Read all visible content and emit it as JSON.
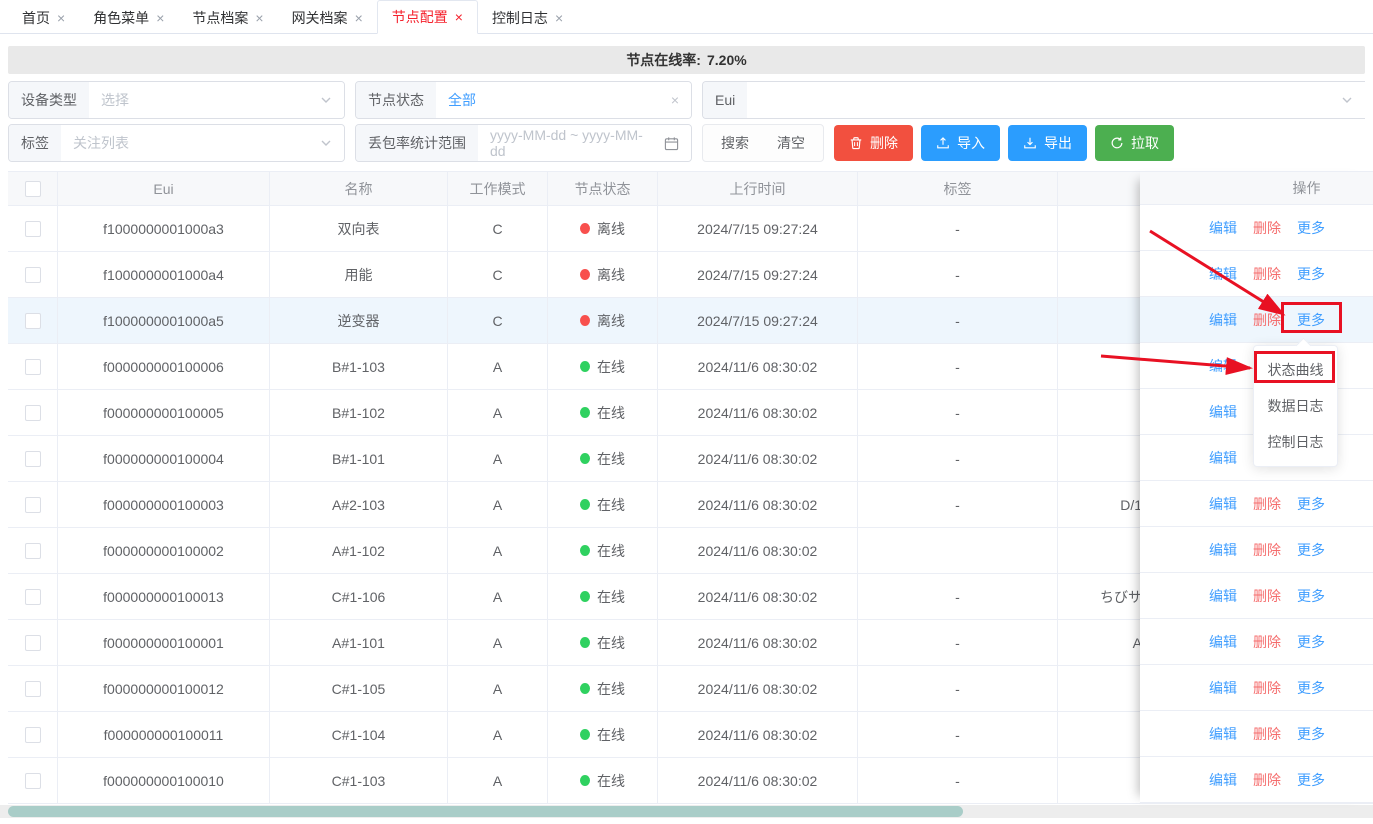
{
  "close_glyph": "×",
  "tabs": [
    {
      "label": "首页",
      "active": false
    },
    {
      "label": "角色菜单",
      "active": false
    },
    {
      "label": "节点档案",
      "active": false
    },
    {
      "label": "网关档案",
      "active": false
    },
    {
      "label": "节点配置",
      "active": true
    },
    {
      "label": "控制日志",
      "active": false
    }
  ],
  "online_rate": {
    "label": "节点在线率:",
    "value": "7.20%"
  },
  "filters": {
    "device_type": {
      "label": "设备类型",
      "placeholder": "选择"
    },
    "node_status": {
      "label": "节点状态",
      "value": "全部"
    },
    "eui": {
      "label": "Eui",
      "value": ""
    },
    "tag": {
      "label": "标签",
      "placeholder": "关注列表"
    },
    "loss_range": {
      "label": "丢包率统计范围",
      "placeholder": "yyyy-MM-dd ~ yyyy-MM-dd"
    }
  },
  "buttons": {
    "search": "搜索",
    "clear": "清空",
    "delete": "删除",
    "import": "导入",
    "export": "导出",
    "pull": "拉取"
  },
  "table": {
    "columns": {
      "eui": "Eui",
      "name": "名称",
      "mode": "工作模式",
      "status": "节点状态",
      "time": "上行时间",
      "tag": "标签",
      "op": "操作"
    },
    "status_online": "在线",
    "status_offline": "离线",
    "actions": {
      "edit": "编辑",
      "delete": "删除",
      "more": "更多"
    },
    "rows": [
      {
        "eui": "f1000000001000a3",
        "name": "双向表",
        "mode": "C",
        "online": false,
        "time": "2024/7/15 09:27:24",
        "tag": "-",
        "extra": "",
        "highlighted": false
      },
      {
        "eui": "f1000000001000a4",
        "name": "用能",
        "mode": "C",
        "online": false,
        "time": "2024/7/15 09:27:24",
        "tag": "-",
        "extra": "",
        "highlighted": false
      },
      {
        "eui": "f1000000001000a5",
        "name": "逆变器",
        "mode": "C",
        "online": false,
        "time": "2024/7/15 09:27:24",
        "tag": "-",
        "extra": "",
        "highlighted": true
      },
      {
        "eui": "f000000000100006",
        "name": "B#1-103",
        "mode": "A",
        "online": true,
        "time": "2024/11/6 08:30:02",
        "tag": "-",
        "extra": "",
        "highlighted": false
      },
      {
        "eui": "f000000000100005",
        "name": "B#1-102",
        "mode": "A",
        "online": true,
        "time": "2024/11/6 08:30:02",
        "tag": "-",
        "extra": "",
        "highlighted": false
      },
      {
        "eui": "f000000000100004",
        "name": "B#1-101",
        "mode": "A",
        "online": true,
        "time": "2024/11/6 08:30:02",
        "tag": "-",
        "extra": "",
        "highlighted": false
      },
      {
        "eui": "f000000000100003",
        "name": "A#2-103",
        "mode": "A",
        "online": true,
        "time": "2024/11/6 08:30:02",
        "tag": "-",
        "extra": "D/1",
        "highlighted": false
      },
      {
        "eui": "f000000000100002",
        "name": "A#1-102",
        "mode": "A",
        "online": true,
        "time": "2024/11/6 08:30:02",
        "tag": "",
        "extra": "",
        "highlighted": false
      },
      {
        "eui": "f000000000100013",
        "name": "C#1-106",
        "mode": "A",
        "online": true,
        "time": "2024/11/6 08:30:02",
        "tag": "-",
        "extra": "ちびサ",
        "highlighted": false
      },
      {
        "eui": "f000000000100001",
        "name": "A#1-101",
        "mode": "A",
        "online": true,
        "time": "2024/11/6 08:30:02",
        "tag": "-",
        "extra": "A",
        "highlighted": false
      },
      {
        "eui": "f000000000100012",
        "name": "C#1-105",
        "mode": "A",
        "online": true,
        "time": "2024/11/6 08:30:02",
        "tag": "-",
        "extra": "",
        "highlighted": false
      },
      {
        "eui": "f000000000100011",
        "name": "C#1-104",
        "mode": "A",
        "online": true,
        "time": "2024/11/6 08:30:02",
        "tag": "-",
        "extra": "",
        "highlighted": false
      },
      {
        "eui": "f000000000100010",
        "name": "C#1-103",
        "mode": "A",
        "online": true,
        "time": "2024/11/6 08:30:02",
        "tag": "-",
        "extra": "",
        "highlighted": false
      }
    ]
  },
  "more_menu": {
    "items": [
      "状态曲线",
      "数据日志",
      "控制日志"
    ]
  },
  "colors": {
    "accent": "#409eff",
    "danger": "#f2503f",
    "link_danger": "#f56c6c",
    "btn_blue": "#2b9dfe",
    "btn_green": "#4caf50",
    "online_dot": "#2fd160",
    "offline_dot": "#f8504d",
    "tab_active": "#f5222d",
    "annotation": "#e81123",
    "bar_bg": "#e9e9e9",
    "row_hl": "#eef6fd",
    "scroll_thumb": "#a9cdc8"
  }
}
